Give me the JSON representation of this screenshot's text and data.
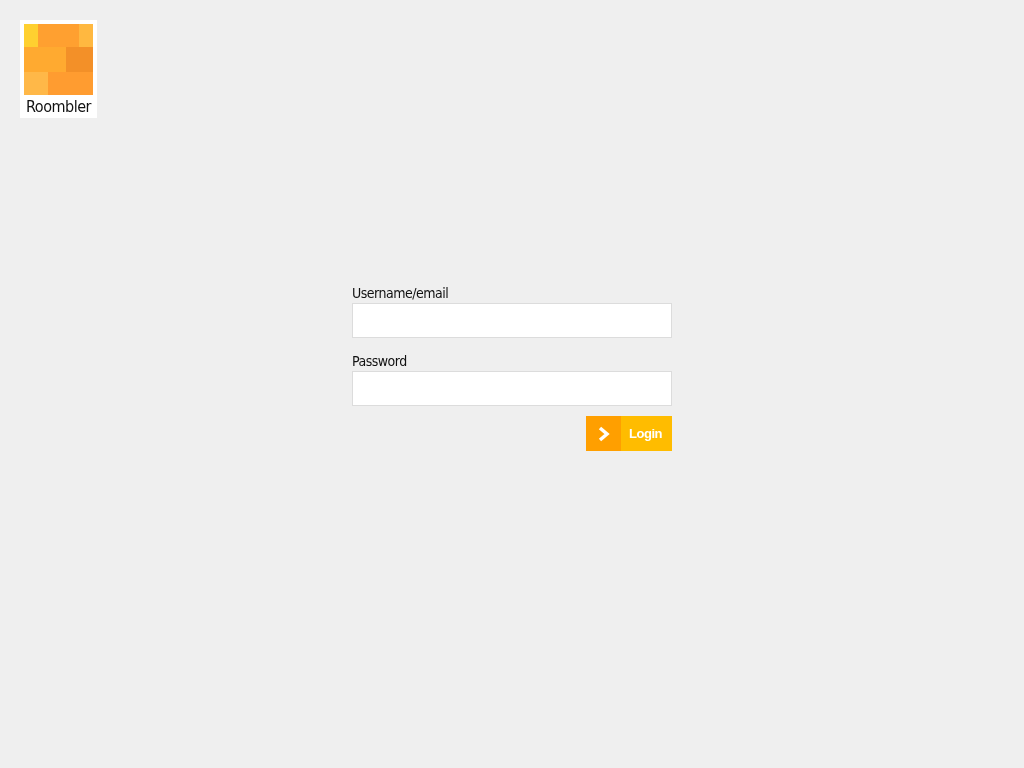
{
  "logo": {
    "name": "Roombler"
  },
  "form": {
    "fields": [
      {
        "label": "Username/email"
      },
      {
        "label": "Password"
      }
    ],
    "button": {
      "label": "Login"
    }
  }
}
